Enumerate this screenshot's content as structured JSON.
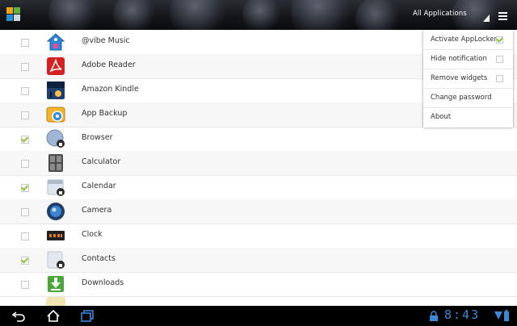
{
  "title_bar": {
    "title": "All Applications"
  },
  "apps": [
    {
      "name": "@vibe Music",
      "checked": false,
      "icon": "vibe-music-house-icon"
    },
    {
      "name": "Adobe Reader",
      "checked": false,
      "icon": "adobe-reader-icon"
    },
    {
      "name": "Amazon Kindle",
      "checked": false,
      "icon": "amazon-kindle-icon"
    },
    {
      "name": "App Backup",
      "checked": false,
      "icon": "app-backup-icon"
    },
    {
      "name": "Browser",
      "checked": true,
      "icon": "browser-globe-locked-icon"
    },
    {
      "name": "Calculator",
      "checked": false,
      "icon": "calculator-icon"
    },
    {
      "name": "Calendar",
      "checked": true,
      "icon": "calendar-locked-icon"
    },
    {
      "name": "Camera",
      "checked": false,
      "icon": "camera-icon"
    },
    {
      "name": "Clock",
      "checked": false,
      "icon": "clock-icon"
    },
    {
      "name": "Contacts",
      "checked": true,
      "icon": "contacts-locked-icon"
    },
    {
      "name": "Downloads",
      "checked": false,
      "icon": "downloads-icon"
    }
  ],
  "menu": {
    "items": [
      {
        "label": "Activate AppLocker",
        "checkbox": true,
        "checked": true
      },
      {
        "label": "Hide notification",
        "checkbox": true,
        "checked": false
      },
      {
        "label": "Remove widgets",
        "checkbox": true,
        "checked": false
      },
      {
        "label": "Change password",
        "checkbox": false
      },
      {
        "label": "About",
        "checkbox": false
      }
    ]
  },
  "status_bar": {
    "time": "8:43"
  },
  "colors": {
    "accent_green": "#8fc43a",
    "clock_blue": "#3a88d6",
    "topbar": "#15171b"
  }
}
